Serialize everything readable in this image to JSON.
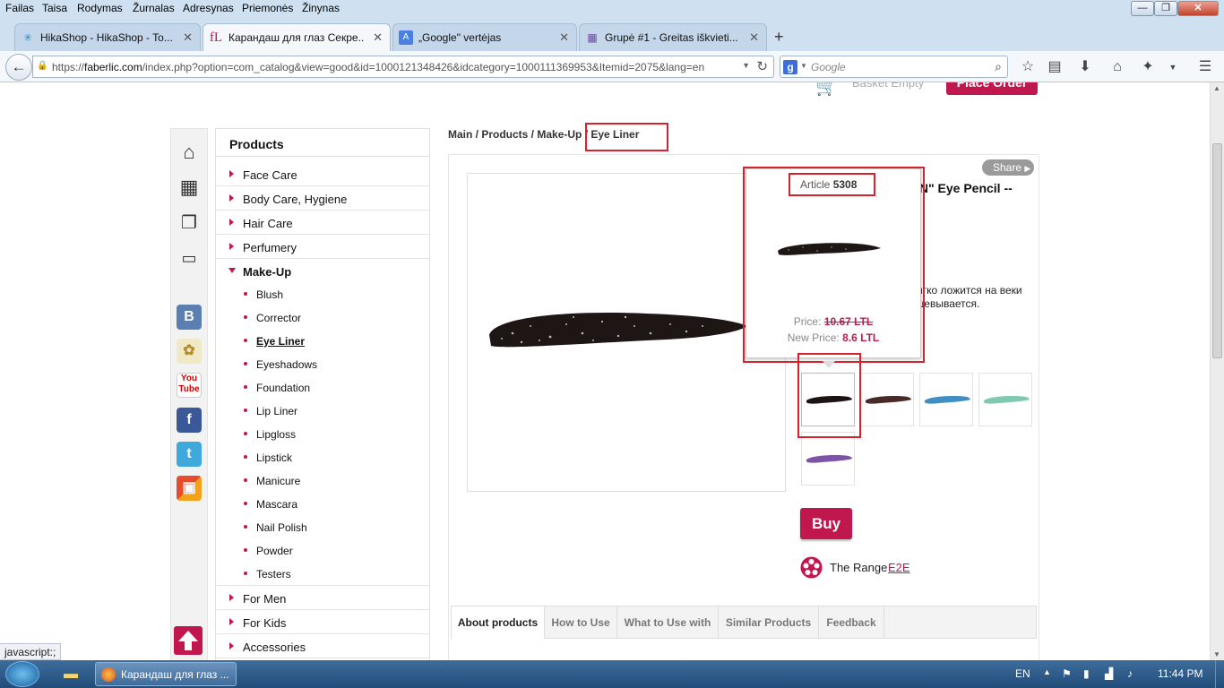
{
  "menubar": {
    "items": [
      "Failas",
      "Taisa",
      "Rodymas",
      "Žurnalas",
      "Adresynas",
      "Priemonės",
      "Žinynas"
    ]
  },
  "window_controls": {
    "minimize": "—",
    "maximize": "❐",
    "close": "✕"
  },
  "tabs": [
    {
      "title": "HikaShop - HikaShop - To...",
      "icon": "hikashop-icon"
    },
    {
      "title": "Карандаш для глаз Секре...",
      "icon": "faberlic-icon"
    },
    {
      "title": "„Google\" vertėjas",
      "icon": "google-translate-icon"
    },
    {
      "title": "Grupė #1 - Greitas iškvieti...",
      "icon": "grid-icon"
    }
  ],
  "navbar": {
    "url_domain": "faberlic.com",
    "url_prefix": "https://",
    "url_rest": "/index.php?option=com_catalog&view=good&id=1000121348426&idcategory=1000111369953&Itemid=2075&lang=en",
    "search_placeholder": "Google"
  },
  "header": {
    "basket": "Basket Empty",
    "place_order": "Place Order"
  },
  "categories": {
    "title": "Products",
    "top_before": [
      "Face Care",
      "Body Care, Hygiene",
      "Hair Care",
      "Perfumery"
    ],
    "open": "Make-Up",
    "sub": [
      "Blush",
      "Corrector",
      "Eye Liner",
      "Eyeshadows",
      "Foundation",
      "Lip Liner",
      "Lipgloss",
      "Lipstick",
      "Manicure",
      "Mascara",
      "Nail Polish",
      "Powder",
      "Testers"
    ],
    "current_sub": "Eye Liner",
    "top_after": [
      "For Men",
      "For Kids",
      "Accessories"
    ]
  },
  "breadcrumb": "Main / Products / Make-Up / Eye Liner",
  "product": {
    "share": "Share",
    "title_fragment": "ON\" Eye Pencil --",
    "desc_line1": "мягко ложится на веки",
    "desc_line2": "ашевывается.",
    "article_label": "Article",
    "article_number": "5308",
    "price_label": "Price:",
    "old_price": "10.67 LTL",
    "new_price_label": "New Price:",
    "new_price": "8.6 LTL",
    "buy": "Buy",
    "range_label": "The Range",
    "range_link": "E2E",
    "thumb_colors": [
      "#1c1412",
      "#4a2a26",
      "#3f8fc4",
      "#7fc9b0",
      "#7b54a8"
    ]
  },
  "product_tabs": [
    "About products",
    "How to Use",
    "What to Use with",
    "Similar Products",
    "Feedback"
  ],
  "status_text": "javascript:;",
  "taskbar": {
    "firefox_task": "Карандаш для глаз ...",
    "lang": "EN",
    "clock": "11:44 PM"
  }
}
